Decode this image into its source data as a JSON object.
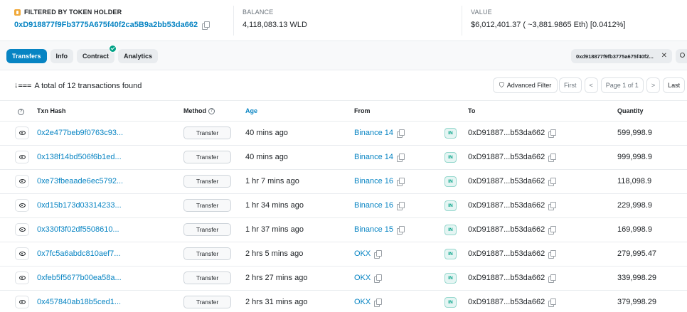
{
  "filter": {
    "holder_label": "FILTERED BY TOKEN HOLDER",
    "holder_address": "0xD918877f9Fb3775A675f40f2ca5B9a2bb53da662",
    "balance_label": "BALANCE",
    "balance_value": "4,118,083.13 WLD",
    "value_label": "VALUE",
    "value_value": "$6,012,401.37 ( ~3,881.9865 Eth) [0.0412%]"
  },
  "tabs": [
    {
      "label": "Transfers"
    },
    {
      "label": "Info"
    },
    {
      "label": "Contract"
    },
    {
      "label": "Analytics"
    }
  ],
  "address_chip": "0xd918877f9fb3775a675f40f2...",
  "summary": {
    "text": "A total of 12 transactions found",
    "advanced_filter": "Advanced Filter",
    "first": "First",
    "prev": "<",
    "page": "Page 1 of 1",
    "next": ">",
    "last": "Last"
  },
  "columns": {
    "txn_hash": "Txn Hash",
    "method": "Method",
    "age": "Age",
    "from": "From",
    "to": "To",
    "quantity": "Quantity"
  },
  "rows": [
    {
      "hash": "0x2e477beb9f0763c93...",
      "method": "Transfer",
      "age": "40 mins ago",
      "from": "Binance 14",
      "dir": "IN",
      "to": "0xD91887...b53da662",
      "qty": "599,998.9"
    },
    {
      "hash": "0x138f14bd506f6b1ed...",
      "method": "Transfer",
      "age": "40 mins ago",
      "from": "Binance 14",
      "dir": "IN",
      "to": "0xD91887...b53da662",
      "qty": "999,998.9"
    },
    {
      "hash": "0xe73fbeaade6ec5792...",
      "method": "Transfer",
      "age": "1 hr 7 mins ago",
      "from": "Binance 16",
      "dir": "IN",
      "to": "0xD91887...b53da662",
      "qty": "118,098.9"
    },
    {
      "hash": "0xd15b173d03314233...",
      "method": "Transfer",
      "age": "1 hr 34 mins ago",
      "from": "Binance 16",
      "dir": "IN",
      "to": "0xD91887...b53da662",
      "qty": "229,998.9"
    },
    {
      "hash": "0x330f3f02df5508610...",
      "method": "Transfer",
      "age": "1 hr 37 mins ago",
      "from": "Binance 15",
      "dir": "IN",
      "to": "0xD91887...b53da662",
      "qty": "169,998.9"
    },
    {
      "hash": "0x7fc5a6abdc810aef7...",
      "method": "Transfer",
      "age": "2 hrs 5 mins ago",
      "from": "OKX",
      "dir": "IN",
      "to": "0xD91887...b53da662",
      "qty": "279,995.47"
    },
    {
      "hash": "0xfeb5f5677b00ea58a...",
      "method": "Transfer",
      "age": "2 hrs 27 mins ago",
      "from": "OKX",
      "dir": "IN",
      "to": "0xD91887...b53da662",
      "qty": "339,998.29"
    },
    {
      "hash": "0x457840ab18b5ced1...",
      "method": "Transfer",
      "age": "2 hrs 31 mins ago",
      "from": "OKX",
      "dir": "IN",
      "to": "0xD91887...b53da662",
      "qty": "379,998.29"
    }
  ],
  "icons": {
    "token": "token-badge-icon",
    "copy": "copy-icon",
    "eye": "eye-icon",
    "info": "info-icon",
    "sort": "sort-icon",
    "filter": "filter-icon",
    "search": "search-icon",
    "close": "close-icon",
    "verified": "check-icon"
  },
  "colors": {
    "accent": "#0784c3",
    "in_badge": "#00a186",
    "token": "#f0a93a"
  }
}
